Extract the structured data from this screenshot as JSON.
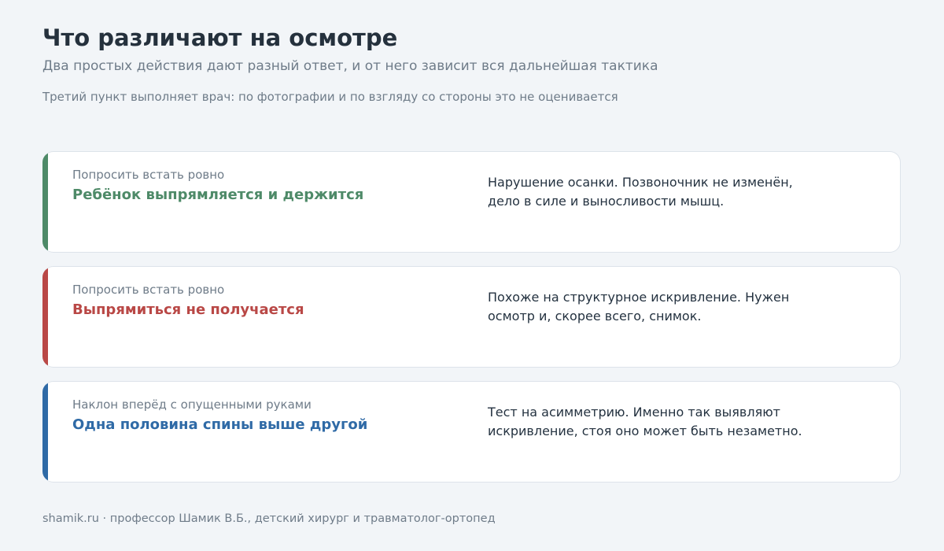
{
  "header": {
    "title": "Что различают на осмотре",
    "subtitle": "Два простых действия дают разный ответ, и от него зависит вся дальнейшая тактика",
    "note": "Третий пункт выполняет врач: по фотографии и по взгляду со стороны это не оценивается"
  },
  "cards": [
    {
      "action": "Попросить встать ровно",
      "result": "Ребёнок выпрямляется и держится",
      "explanation": "Нарушение осанки. Позвоночник не изменён, дело в силе и выносливости мышц.",
      "accent_color": "#4e8a68"
    },
    {
      "action": "Попросить встать ровно",
      "result": "Выпрямиться не получается",
      "explanation": "Похоже на структурное искривление. Нужен осмотр и, скорее всего, снимок.",
      "accent_color": "#b94846"
    },
    {
      "action": "Наклон вперёд с опущенными руками",
      "result": "Одна половина спины выше другой",
      "explanation": "Тест на асимметрию. Именно так выявляют искривление, стоя оно может быть незаметно.",
      "accent_color": "#2f6aa6"
    }
  ],
  "footer": {
    "text": "shamik.ru · профессор Шамик В.Б., детский хирург и травматолог-ортопед"
  }
}
